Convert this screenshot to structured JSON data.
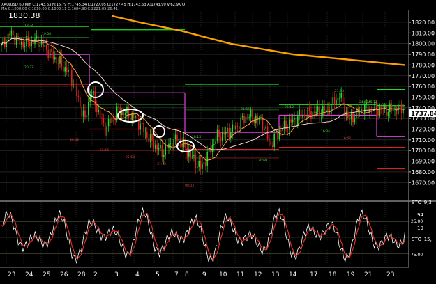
{
  "header": {
    "symbol_line": "XAU/USD 60 Min  C:1743.63  N:15.79  H:1745.34  L:1727.05  O:1727.45  H:1743.63  A:1743.99  V:62.9K  O",
    "ma_line": "MA C:1808.00  C:1810.06  C:1803.11  C:1684.90  C:2221:05  26:41",
    "time_badge": "1830.38"
  },
  "price_axis": {
    "labels": [
      "1820.00",
      "1810.00",
      "1800.00",
      "1790.00",
      "1780.00",
      "1770.00",
      "1760.00",
      "1750.00",
      "1740.00",
      "1730.00",
      "1720.00",
      "1710.00",
      "1700.00",
      "1690.00",
      "1680.00",
      "1670.00"
    ],
    "current_price": "1737.84"
  },
  "date_axis": [
    "23",
    "24",
    "25",
    "26",
    "28",
    "2",
    "3",
    "4",
    "5",
    "7",
    "8",
    "9",
    "10",
    "11",
    "12",
    "13",
    "14",
    "17",
    "18",
    "19",
    "21",
    "23"
  ],
  "oscillator": {
    "label_top": "STO_9,3",
    "label_mid": "STO_15,",
    "value_a": "94",
    "value_b": "19",
    "level_top": "25.00",
    "level_bottom": "75.00"
  },
  "annotations": {
    "price_labels": [
      "18:24",
      "19:08",
      "20:37",
      "21:33",
      "21:65",
      "26:12",
      "24,5745.72",
      "41:00",
      "16:34",
      "16:42",
      "30:43",
      "52:54",
      "25:58",
      "37:42",
      "90:03",
      "30:69",
      "18:13"
    ]
  },
  "colors": {
    "background": "#000000",
    "grid": "#3a3a3a",
    "candle_up": "#2fd22f",
    "candle_down": "#e02020",
    "ma_fast": "#f0a040",
    "ma_slow": "#f0d0c0",
    "ma_long": "#ffa000",
    "pivot_magenta": "#e040e0",
    "pivot_green": "#20e020",
    "pivot_red": "#e02020",
    "sto_k": "#ffffff",
    "sto_d": "#e03020",
    "circle": "#ffffff"
  }
}
